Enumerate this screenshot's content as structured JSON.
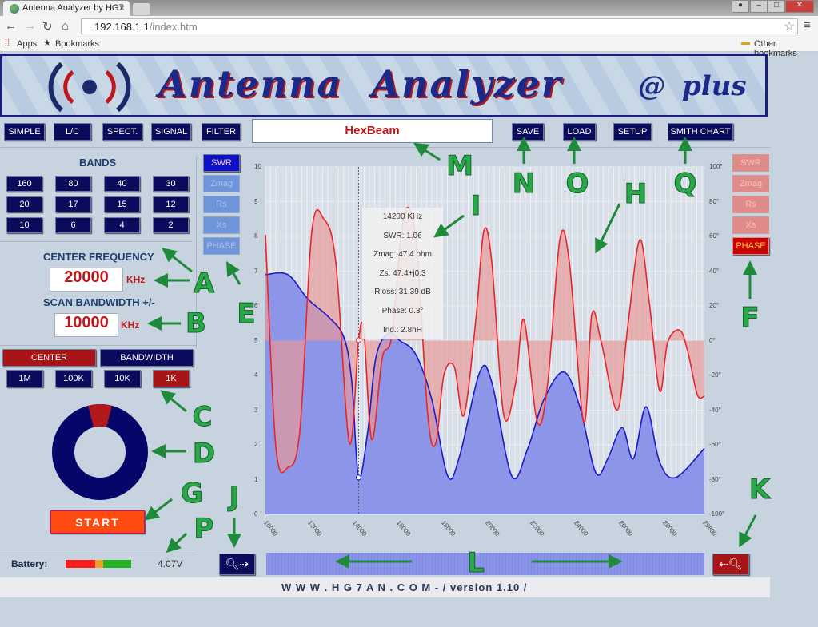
{
  "browser": {
    "tab_title": "Antenna Analyzer by HG7",
    "url_host": "192.168.1.1",
    "url_path": "/index.htm",
    "bookmarks": [
      "Apps",
      "Bookmarks"
    ],
    "other_bookmarks": "Other bookmarks"
  },
  "banner": {
    "title": "Antenna  Analyzer",
    "at": "@",
    "plus": "plus"
  },
  "nav": {
    "modes": [
      "SIMPLE",
      "L/C",
      "SPECT.",
      "SIGNAL",
      "FILTER"
    ],
    "project_name": "HexBeam",
    "actions": [
      "SAVE",
      "LOAD",
      "SETUP",
      "SMITH CHART"
    ]
  },
  "bands": {
    "title": "BANDS",
    "items": [
      "160",
      "80",
      "40",
      "30",
      "20",
      "17",
      "15",
      "12",
      "10",
      "6",
      "4",
      "2"
    ]
  },
  "center_frequency": {
    "label": "CENTER FREQUENCY",
    "value": "20000",
    "unit": "KHz"
  },
  "scan_bandwidth": {
    "label": "SCAN BANDWIDTH +/-",
    "value": "10000",
    "unit": "KHz"
  },
  "step": {
    "mode_buttons": [
      "CENTER",
      "BANDWIDTH"
    ],
    "active_mode": "CENTER",
    "steps": [
      "1M",
      "100K",
      "10K",
      "1K"
    ],
    "active_step": "1K"
  },
  "progress": {
    "label": "",
    "segment_fraction": 0.08
  },
  "start_label": "START",
  "battery": {
    "label": "Battery:",
    "voltage": "4.07V",
    "colors": [
      "#ff1b1b",
      "#f0a020",
      "#22b222"
    ]
  },
  "left_traces": {
    "items": [
      "SWR",
      "Zmag",
      "Rs",
      "Xs",
      "PHASE"
    ],
    "active": "SWR"
  },
  "right_traces": {
    "items": [
      "SWR",
      "Zmag",
      "Rs",
      "Xs",
      "PHASE"
    ],
    "active": "PHASE"
  },
  "tooltip": [
    "14200 KHz",
    "SWR: 1.06",
    "Zmag: 47.4 ohm",
    "Zs: 47.4+j0.3",
    "Rloss: 31.39 dB",
    "Phase: 0.3°",
    "Ind.: 2.8nH"
  ],
  "footer": "W W W . H G 7 A N . C O M - / version 1.10 /",
  "annotations": [
    "A",
    "B",
    "C",
    "D",
    "E",
    "F",
    "G",
    "H",
    "I",
    "J",
    "K",
    "L",
    "M",
    "N",
    "O",
    "P",
    "Q"
  ],
  "colors": {
    "navy": "#0b0b5e",
    "swr_line": "#1a1ac8",
    "swr_fill": "#8890e8",
    "phase_line": "#e8262a",
    "phase_fill": "#e79a9a",
    "arrow": "#1e8a3a"
  },
  "chart_data": {
    "type": "line",
    "xlim": [
      10000,
      29800
    ],
    "x_ticks": [
      "10000",
      "12000",
      "14000",
      "16000",
      "18000",
      "20000",
      "22000",
      "24000",
      "26000",
      "28000",
      "29800"
    ],
    "y_left": {
      "ylim": [
        0,
        10
      ],
      "ticks": [
        "0",
        "1",
        "2",
        "3",
        "4",
        "5",
        "6",
        "7",
        "8",
        "9",
        "10"
      ]
    },
    "y_right": {
      "ylim": [
        -100,
        100
      ],
      "ticks": [
        "-100°",
        "-80°",
        "-60°",
        "-40°",
        "-20°",
        "0°",
        "20°",
        "40°",
        "60°",
        "80°",
        "100°"
      ]
    },
    "grid": true,
    "cursor_x": 14200,
    "series": [
      {
        "axis": "left",
        "color": "#1a1ac8",
        "fill": "#8890e8",
        "points": [
          [
            10000,
            6.9
          ],
          [
            11010,
            6.9
          ],
          [
            11912,
            6.2
          ],
          [
            12814,
            5.7
          ],
          [
            13535,
            5.1
          ],
          [
            13896,
            3.8
          ],
          [
            14200,
            1.06
          ],
          [
            14616,
            2.4
          ],
          [
            14977,
            4.5
          ],
          [
            15518,
            5.2
          ],
          [
            16060,
            5.0
          ],
          [
            16781,
            4.6
          ],
          [
            17502,
            3.3
          ],
          [
            18224,
            1.1
          ],
          [
            18765,
            1.7
          ],
          [
            19667,
            4.1
          ],
          [
            20208,
            3.8
          ],
          [
            21110,
            1.1
          ],
          [
            21831,
            1.9
          ],
          [
            22552,
            3.3
          ],
          [
            23454,
            4.1
          ],
          [
            24175,
            3.1
          ],
          [
            24897,
            1.2
          ],
          [
            25438,
            1.6
          ],
          [
            26087,
            2.5
          ],
          [
            26592,
            1.6
          ],
          [
            27170,
            3.1
          ],
          [
            27783,
            1.5
          ],
          [
            28504,
            1.06
          ],
          [
            29800,
            1.9
          ]
        ]
      },
      {
        "axis": "right",
        "color": "#e8262a",
        "fill": "#e79a9a",
        "points": [
          [
            10000,
            61
          ],
          [
            10469,
            -61
          ],
          [
            11010,
            -73
          ],
          [
            11551,
            -52
          ],
          [
            12092,
            63
          ],
          [
            12633,
            70
          ],
          [
            13174,
            45
          ],
          [
            13787,
            -59
          ],
          [
            14200,
            0.3
          ],
          [
            14437,
            5
          ],
          [
            14797,
            -57
          ],
          [
            15266,
            -10
          ],
          [
            15699,
            3
          ],
          [
            16240,
            72
          ],
          [
            16781,
            58
          ],
          [
            17322,
            -43
          ],
          [
            17683,
            -59
          ],
          [
            18044,
            -20
          ],
          [
            18513,
            -15
          ],
          [
            18946,
            -43
          ],
          [
            19487,
            12
          ],
          [
            19847,
            63
          ],
          [
            20208,
            45
          ],
          [
            20749,
            -43
          ],
          [
            21290,
            -24
          ],
          [
            21651,
            12
          ],
          [
            22264,
            -47
          ],
          [
            22733,
            -24
          ],
          [
            23274,
            58
          ],
          [
            23707,
            45
          ],
          [
            24356,
            -47
          ],
          [
            24717,
            15
          ],
          [
            25149,
            -1
          ],
          [
            25871,
            -40
          ],
          [
            26340,
            8
          ],
          [
            26881,
            58
          ],
          [
            27314,
            22
          ],
          [
            27783,
            -29
          ],
          [
            28143,
            -1
          ],
          [
            28685,
            6
          ],
          [
            29045,
            -6
          ],
          [
            29477,
            -31
          ],
          [
            29800,
            -32
          ]
        ]
      }
    ]
  }
}
